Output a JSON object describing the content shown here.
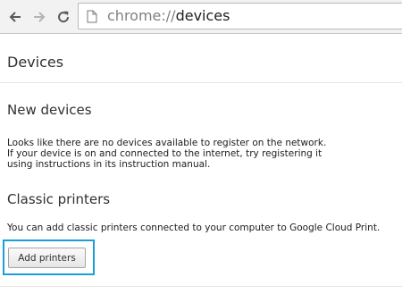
{
  "browser": {
    "url_scheme": "chrome://",
    "url_host": "devices"
  },
  "page": {
    "title": "Devices"
  },
  "new_devices": {
    "heading": "New devices",
    "lines": [
      "Looks like there are no devices available to register on the network.",
      "If your device is on and connected to the internet, try registering it",
      "using instructions in its instruction manual."
    ]
  },
  "classic_printers": {
    "heading": "Classic printers",
    "description": "You can add classic printers connected to your computer to Google Cloud Print.",
    "add_button_label": "Add printers"
  },
  "colors": {
    "highlight": "#1a9fd9"
  }
}
